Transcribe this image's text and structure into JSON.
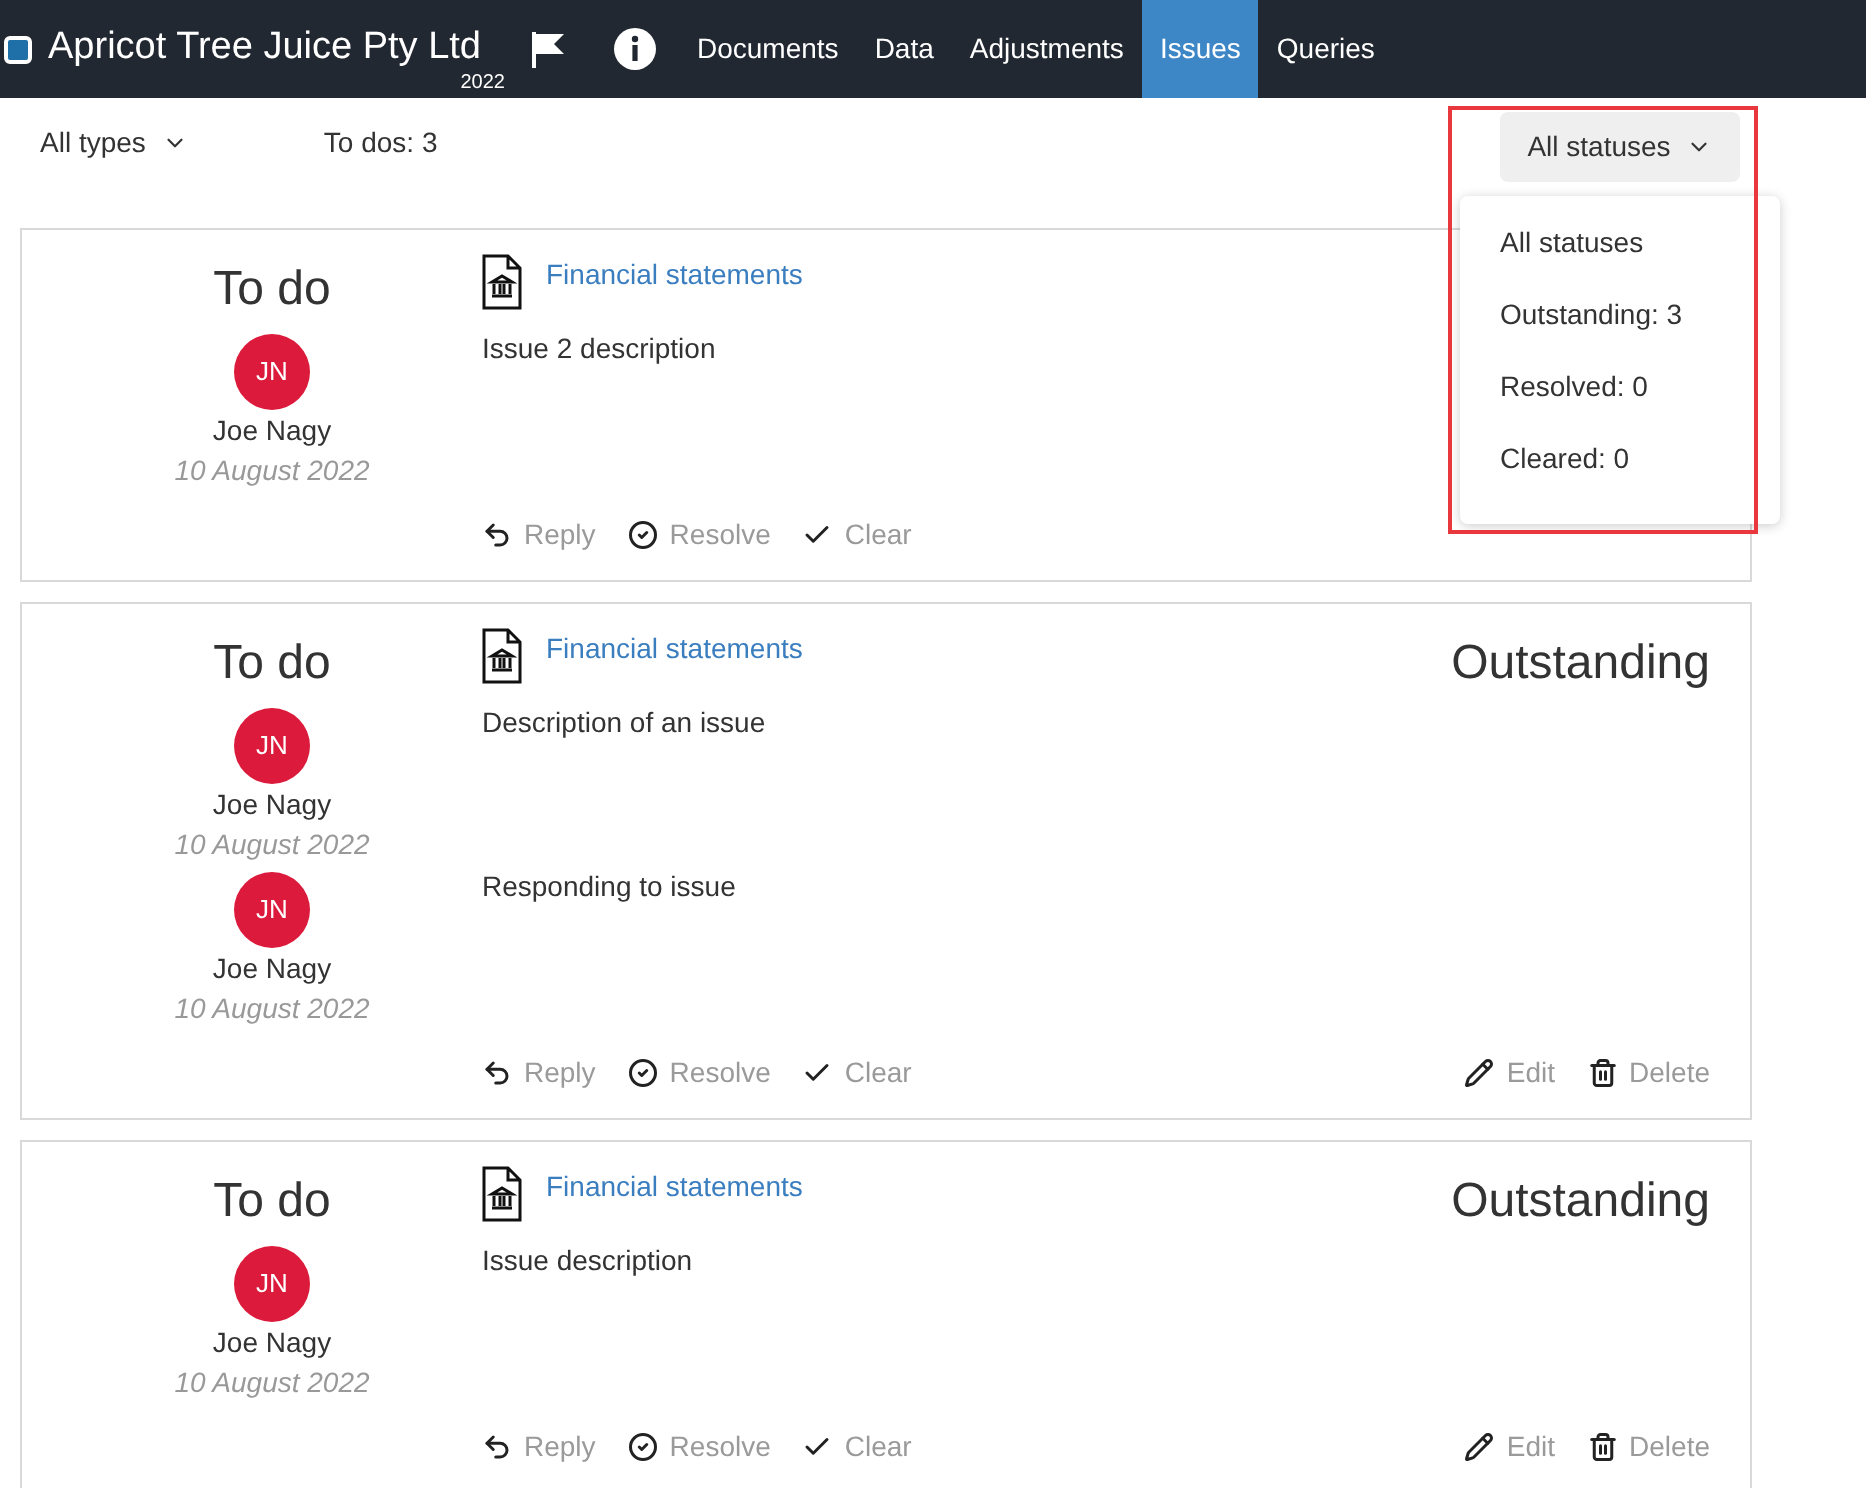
{
  "header": {
    "company": "Apricot Tree Juice Pty Ltd",
    "year": "2022",
    "nav": [
      {
        "label": "Documents",
        "selected": false
      },
      {
        "label": "Data",
        "selected": false
      },
      {
        "label": "Adjustments",
        "selected": false
      },
      {
        "label": "Issues",
        "selected": true
      },
      {
        "label": "Queries",
        "selected": false
      }
    ]
  },
  "toolbar": {
    "type_filter": "All types",
    "todo_count": "To dos: 3",
    "status_filter": "All statuses"
  },
  "status_menu": {
    "highlighted": true,
    "items": [
      "All statuses",
      "Outstanding: 3",
      "Resolved: 0",
      "Cleared: 0"
    ]
  },
  "issues": [
    {
      "category": "To do",
      "document": "Financial statements",
      "comments": [
        {
          "initials": "JN",
          "author": "Joe Nagy",
          "date": "10 August 2022",
          "text": "Issue 2 description"
        }
      ],
      "actions": [
        {
          "kind": "reply",
          "label": "Reply"
        },
        {
          "kind": "resolve",
          "label": "Resolve"
        },
        {
          "kind": "clear",
          "label": "Clear"
        }
      ]
    },
    {
      "category": "To do",
      "document": "Financial statements",
      "status": "Outstanding",
      "comments": [
        {
          "initials": "JN",
          "author": "Joe Nagy",
          "date": "10 August 2022",
          "text": "Description of an issue"
        },
        {
          "initials": "JN",
          "author": "Joe Nagy",
          "date": "10 August 2022",
          "text": "Responding to issue"
        }
      ],
      "actions": [
        {
          "kind": "reply",
          "label": "Reply"
        },
        {
          "kind": "resolve",
          "label": "Resolve"
        },
        {
          "kind": "clear",
          "label": "Clear"
        },
        {
          "kind": "edit",
          "label": "Edit"
        },
        {
          "kind": "delete",
          "label": "Delete"
        }
      ]
    },
    {
      "category": "To do",
      "document": "Financial statements",
      "status": "Outstanding",
      "comments": [
        {
          "initials": "JN",
          "author": "Joe Nagy",
          "date": "10 August 2022",
          "text": "Issue description"
        }
      ],
      "actions": [
        {
          "kind": "reply",
          "label": "Reply"
        },
        {
          "kind": "resolve",
          "label": "Resolve"
        },
        {
          "kind": "clear",
          "label": "Clear"
        },
        {
          "kind": "edit",
          "label": "Edit"
        },
        {
          "kind": "delete",
          "label": "Delete"
        }
      ]
    }
  ]
}
